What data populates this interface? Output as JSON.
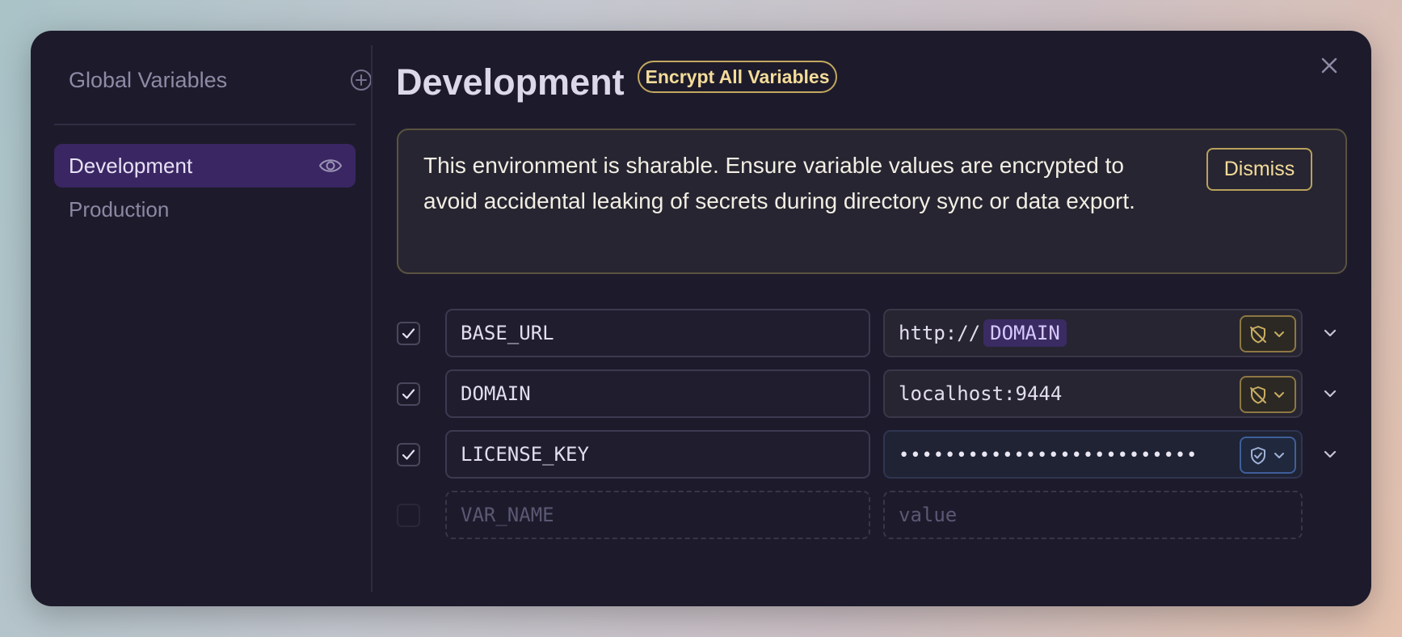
{
  "sidebar": {
    "title": "Global Variables",
    "items": [
      {
        "label": "Development",
        "active": true
      },
      {
        "label": "Production",
        "active": false
      }
    ]
  },
  "header": {
    "title": "Development",
    "encrypt_label": "Encrypt All Variables"
  },
  "notice": {
    "text": "This environment is sharable. Ensure variable values are encrypted to avoid accidental leaking of secrets during directory sync or data export.",
    "dismiss_label": "Dismiss"
  },
  "variables": [
    {
      "enabled": true,
      "name": "BASE_URL",
      "value_prefix": "http://",
      "value_ref": "DOMAIN",
      "encrypted": false
    },
    {
      "enabled": true,
      "name": "DOMAIN",
      "value": "localhost:9444",
      "encrypted": false
    },
    {
      "enabled": true,
      "name": "LICENSE_KEY",
      "value_masked": "••••••••••••••••••••••••••",
      "encrypted": true
    }
  ],
  "new_row": {
    "name_placeholder": "VAR_NAME",
    "value_placeholder": "value"
  },
  "colors": {
    "dialog_bg": "#1d1b2b",
    "active_item_bg": "#3a2663",
    "warning_accent": "#f4dc9a",
    "variable_chip_bg": "#3a2b63",
    "encrypted_accent": "#3f5f99"
  },
  "icons": {
    "add": "plus-circle-icon",
    "visibility": "eye-icon",
    "close": "close-icon",
    "checkbox": "check-icon",
    "unencrypted": "shield-off-icon",
    "encrypted": "shield-check-icon",
    "expand": "chevron-down-icon"
  }
}
